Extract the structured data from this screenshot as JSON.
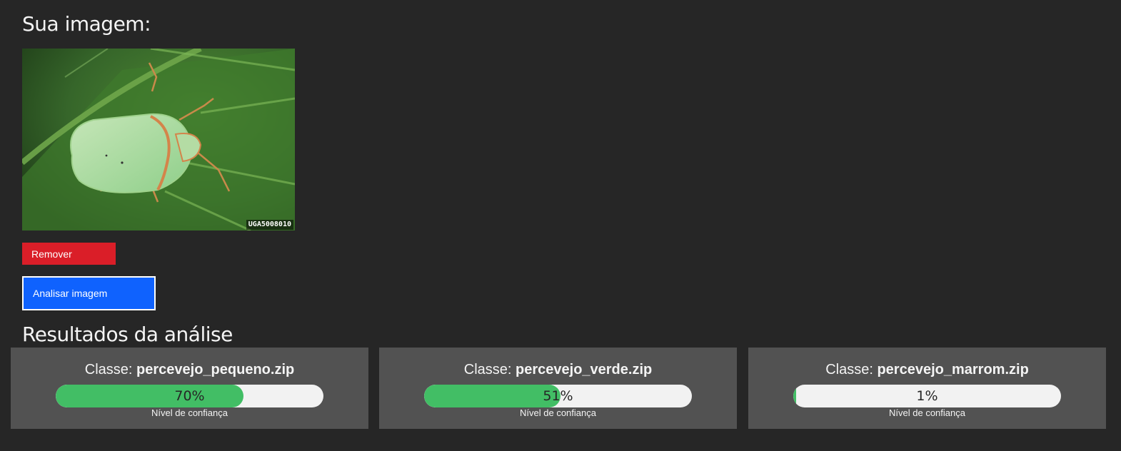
{
  "upload": {
    "heading": "Sua imagem:",
    "watermark": "UGA5008010",
    "remove_label": "Remover",
    "analyze_label": "Analisar imagem"
  },
  "results": {
    "heading": "Resultados da análise",
    "class_prefix": "Classe:",
    "confidence_caption": "Nível de confiança",
    "items": [
      {
        "class_name": "percevejo_pequeno.zip",
        "confidence_label": "70%",
        "confidence": 0.7
      },
      {
        "class_name": "percevejo_verde.zip",
        "confidence_label": "51%",
        "confidence": 0.51
      },
      {
        "class_name": "percevejo_marrom.zip",
        "confidence_label": "1%",
        "confidence": 0.01
      }
    ]
  },
  "colors": {
    "background": "#262626",
    "card": "#525252",
    "remove": "#da1e28",
    "analyze": "#0f62fe",
    "progress": "#42be65"
  }
}
